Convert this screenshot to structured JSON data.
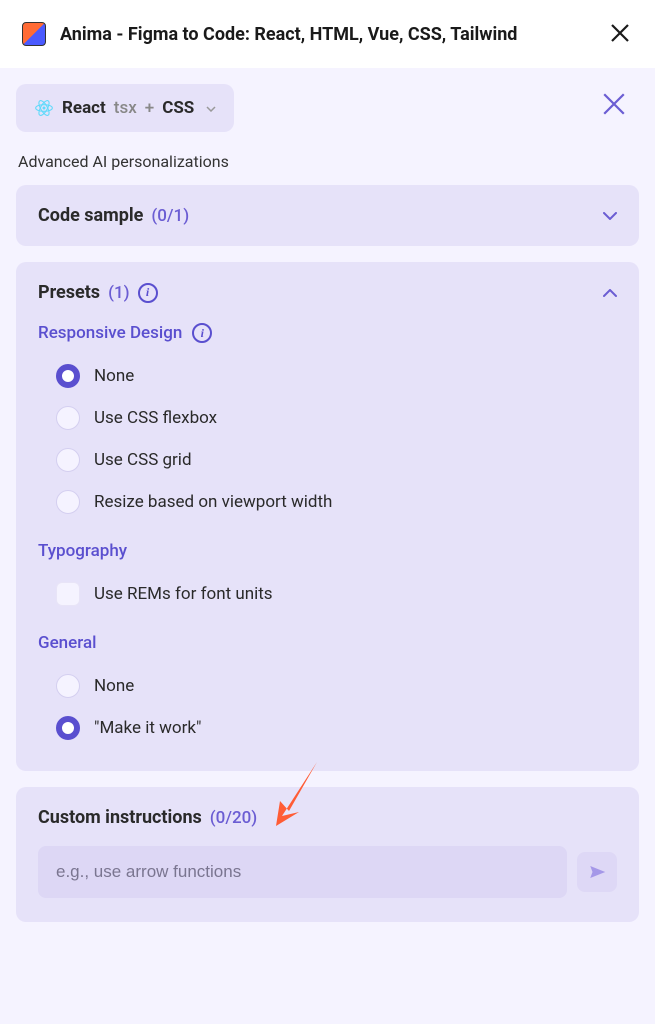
{
  "header": {
    "title": "Anima - Figma to Code: React, HTML, Vue, CSS, Tailwind"
  },
  "framework": {
    "name": "React",
    "ext": "tsx",
    "joiner": "+",
    "style": "CSS"
  },
  "subtitle": "Advanced AI personalizations",
  "sections": {
    "codeSample": {
      "title": "Code sample",
      "count": "(0/1)"
    },
    "presets": {
      "title": "Presets",
      "count": "(1)",
      "groups": {
        "responsive": {
          "label": "Responsive Design",
          "options": [
            {
              "label": "None",
              "selected": true
            },
            {
              "label": "Use CSS flexbox",
              "selected": false
            },
            {
              "label": "Use CSS grid",
              "selected": false
            },
            {
              "label": "Resize based on viewport width",
              "selected": false
            }
          ]
        },
        "typography": {
          "label": "Typography",
          "options": [
            {
              "label": "Use REMs for font units",
              "selected": false
            }
          ]
        },
        "general": {
          "label": "General",
          "options": [
            {
              "label": "None",
              "selected": false
            },
            {
              "label": "\"Make it work\"",
              "selected": true
            }
          ]
        }
      }
    },
    "custom": {
      "title": "Custom instructions",
      "count": "(0/20)",
      "placeholder": "e.g., use arrow functions"
    }
  }
}
